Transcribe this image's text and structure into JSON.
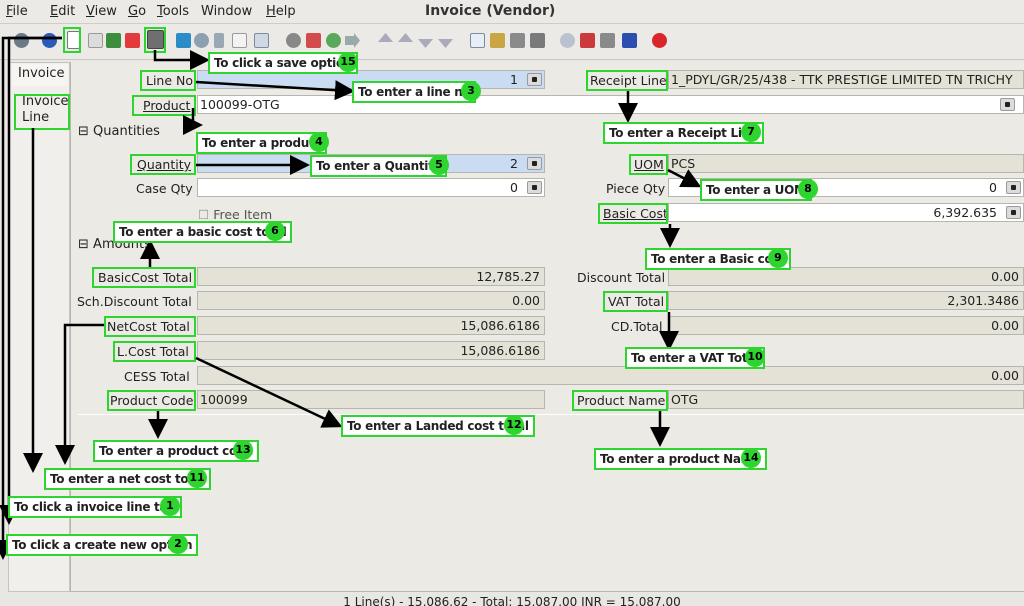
{
  "menu": {
    "file": "File",
    "edit": "Edit",
    "view": "View",
    "go": "Go",
    "tools": "Tools",
    "window": "Window",
    "help": "Help"
  },
  "window_title": "Invoice (Vendor)",
  "tabs": {
    "invoice": "Invoice",
    "invoice_line": "Invoice\nLine"
  },
  "form": {
    "line_no": {
      "label": "Line No",
      "value": "1"
    },
    "receipt_line": {
      "label": "Receipt Line",
      "value": "1_PDYL/GR/25/438 - TTK PRESTIGE LIMITED TN TRICHY"
    },
    "product": {
      "label": "Product",
      "value": "100099-OTG"
    },
    "quantities_section": "Quantities",
    "quantity": {
      "label": "Quantity",
      "value": "2"
    },
    "uom": {
      "label": "UOM",
      "value": "PCS"
    },
    "case_qty": {
      "label": "Case Qty",
      "value": "0"
    },
    "piece_qty": {
      "label": "Piece Qty",
      "value": "0"
    },
    "free_item": "Free Item",
    "basic_cost": {
      "label": "Basic Cost",
      "value": "6,392.635"
    },
    "amounts_section": "Amounts",
    "basiccost_total": {
      "label": "BasicCost Total",
      "value": "12,785.27"
    },
    "discount_total": {
      "label": "Discount Total",
      "value": "0.00"
    },
    "sch_discount_total": {
      "label": "Sch.Discount Total",
      "value": "0.00"
    },
    "vat_total": {
      "label": "VAT Total",
      "value": "2,301.3486"
    },
    "netcost_total": {
      "label": "NetCost Total",
      "value": "15,086.6186"
    },
    "cd_total": {
      "label": "CD.Total",
      "value": "0.00"
    },
    "lcost_total": {
      "label": "L.Cost Total",
      "value": "15,086.6186"
    },
    "cess_total": {
      "label": "CESS Total",
      "value": "0.00"
    },
    "product_code": {
      "label": "Product Code",
      "value": "100099"
    },
    "product_name": {
      "label": "Product Name",
      "value": "OTG"
    }
  },
  "callouts": {
    "c1": {
      "text": "To click a invoice line tab",
      "n": "1"
    },
    "c2": {
      "text": "To click a create new option",
      "n": "2"
    },
    "c3": {
      "text": "To enter a line no",
      "n": "3"
    },
    "c4": {
      "text": "To enter a product",
      "n": "4"
    },
    "c5": {
      "text": "To enter a Quantity",
      "n": "5"
    },
    "c6": {
      "text": "To enter a basic cost total",
      "n": "6"
    },
    "c7": {
      "text": "To enter a Receipt Line",
      "n": "7"
    },
    "c8": {
      "text": "To enter a UOM",
      "n": "8"
    },
    "c9": {
      "text": "To enter a Basic cost",
      "n": "9"
    },
    "c10": {
      "text": "To enter a VAT Total",
      "n": "10"
    },
    "c11": {
      "text": "To enter a net cost total",
      "n": "11"
    },
    "c12": {
      "text": "To enter a Landed cost total",
      "n": "12"
    },
    "c13": {
      "text": "To enter a product code",
      "n": "13"
    },
    "c14": {
      "text": "To enter a product Name",
      "n": "14"
    },
    "c15": {
      "text": "To click a save option",
      "n": "15"
    }
  },
  "status": "1 Line(s) - 15,086.62 -  Total: 15,087.00  INR  =  15,087.00",
  "colors": {
    "annotation": "#2fd52f",
    "highlight_field": "#c9dcf2"
  }
}
